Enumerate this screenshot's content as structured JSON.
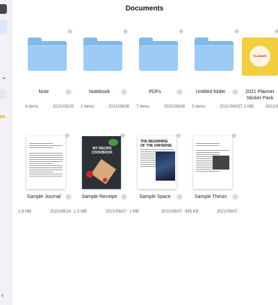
{
  "page": {
    "title": "Documents"
  },
  "sidebar": {
    "partial_label": "es"
  },
  "folders": [
    {
      "name": "Note",
      "count": "4 items",
      "date": "2021/05/25"
    },
    {
      "name": "Notebook",
      "count": "1 items",
      "date": "2021/06/08"
    },
    {
      "name": "PDFs",
      "count": "7 items",
      "date": "2021/06/08"
    },
    {
      "name": "Untitled folder",
      "count": "3 items",
      "date": "2021/06/03"
    },
    {
      "name": "2021 Planner Sticker Pack",
      "count": "7.2 MB",
      "date": "2021/0"
    }
  ],
  "files": [
    {
      "name": "Sample Journal",
      "size": "1.9 MB",
      "date": "2021/06/14"
    },
    {
      "name": "Sample Receipe",
      "size": "1.3 MB",
      "date": "2021/06/07",
      "cover": "MY RECIPE COOKBOOK"
    },
    {
      "name": "Sample Space",
      "size": "1 MB",
      "date": "2021/06/07",
      "cover": "THE BEGINNING OF THE UNIVERSE"
    },
    {
      "name": "Sample Thesis",
      "size": "945 KB",
      "date": "2021/06/07"
    }
  ],
  "colors": {
    "folder": "#9ccbf5",
    "accent": "#e49b12",
    "sticker": "#f2ce3f"
  }
}
